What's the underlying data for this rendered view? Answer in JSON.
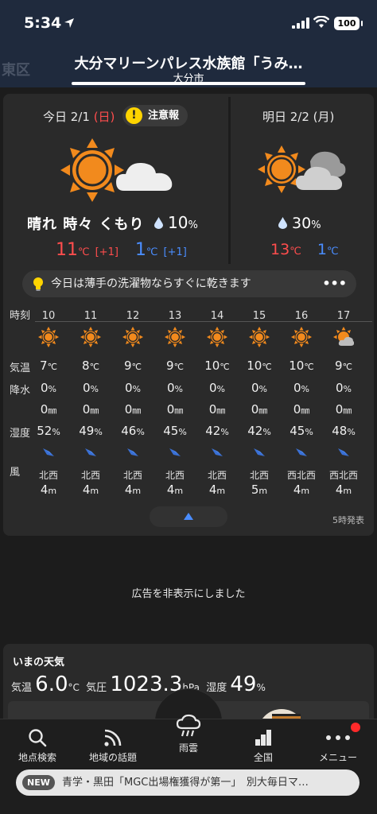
{
  "status": {
    "time": "5:34",
    "battery": "100"
  },
  "header": {
    "ghost": "東区",
    "title": "大分マリーンパレス水族館「うみ…",
    "subtitle": "大分市"
  },
  "today": {
    "label": "今日 2/1 ",
    "weekday": "(日)",
    "warning": "注意報",
    "weather": "晴れ 時々 くもり",
    "rain": "10",
    "rain_unit": "%",
    "hi": "11",
    "hi_diff": "[+1]",
    "lo": "1",
    "lo_diff": "[+1]",
    "temp_unit": "℃"
  },
  "tomorrow": {
    "label": "明日 2/2 (月)",
    "rain": "30",
    "rain_unit": "%",
    "hi": "13",
    "lo": "1",
    "temp_unit": "℃"
  },
  "tip": {
    "text": "今日は薄手の洗濯物ならすぐに乾きます",
    "more": "•••"
  },
  "hourly": {
    "labels": {
      "hour": "時刻",
      "temp": "気温",
      "precip": "降水",
      "humidity": "湿度",
      "wind": "風"
    },
    "units": {
      "temp": "℃",
      "precip": "%",
      "mm": "㎜",
      "humidity": "%",
      "speed": "m"
    },
    "hours": [
      {
        "h": "10",
        "icon": "sun-icon",
        "temp": "7",
        "precip": "0",
        "mm": "0",
        "hum": "52",
        "dir": "北西",
        "speed": "4"
      },
      {
        "h": "11",
        "icon": "sun-icon",
        "temp": "8",
        "precip": "0",
        "mm": "0",
        "hum": "49",
        "dir": "北西",
        "speed": "4"
      },
      {
        "h": "12",
        "icon": "sun-icon",
        "temp": "9",
        "precip": "0",
        "mm": "0",
        "hum": "46",
        "dir": "北西",
        "speed": "4"
      },
      {
        "h": "13",
        "icon": "sun-icon",
        "temp": "9",
        "precip": "0",
        "mm": "0",
        "hum": "45",
        "dir": "北西",
        "speed": "4"
      },
      {
        "h": "14",
        "icon": "sun-icon",
        "temp": "10",
        "precip": "0",
        "mm": "0",
        "hum": "42",
        "dir": "北西",
        "speed": "4"
      },
      {
        "h": "15",
        "icon": "sun-icon",
        "temp": "10",
        "precip": "0",
        "mm": "0",
        "hum": "42",
        "dir": "北西",
        "speed": "5"
      },
      {
        "h": "16",
        "icon": "sun-icon",
        "temp": "10",
        "precip": "0",
        "mm": "0",
        "hum": "45",
        "dir": "西北西",
        "speed": "4"
      },
      {
        "h": "17",
        "icon": "sun-cloud-icon",
        "temp": "9",
        "precip": "0",
        "mm": "0",
        "hum": "48",
        "dir": "西北西",
        "speed": "4"
      }
    ],
    "issued": "5時発表"
  },
  "ad_note": "広告を非表示にしました",
  "now": {
    "title": "いまの天気",
    "temp_label": "気温",
    "temp": "6.0",
    "temp_unit": "°C",
    "pressure_label": "気圧",
    "pressure": "1023.3",
    "pressure_unit": "hPa",
    "humidity_label": "湿度",
    "humidity": "49",
    "humidity_unit": "%"
  },
  "tabs": [
    {
      "label": "地点検索",
      "icon": "search-icon"
    },
    {
      "label": "地域の話題",
      "icon": "rss-icon"
    },
    {
      "label": "雨雲",
      "icon": "rain-cloud-icon"
    },
    {
      "label": "全国",
      "icon": "chart-icon"
    },
    {
      "label": "メニュー",
      "icon": "more-icon"
    }
  ],
  "news": {
    "badge": "NEW",
    "text": "青学・黒田「MGC出場権獲得が第一」　別大毎日マ…"
  },
  "colors": {
    "sun": "#f28a1d",
    "hi": "#ff4d4d",
    "lo": "#4a8dff",
    "accent": "#4a8dff"
  }
}
